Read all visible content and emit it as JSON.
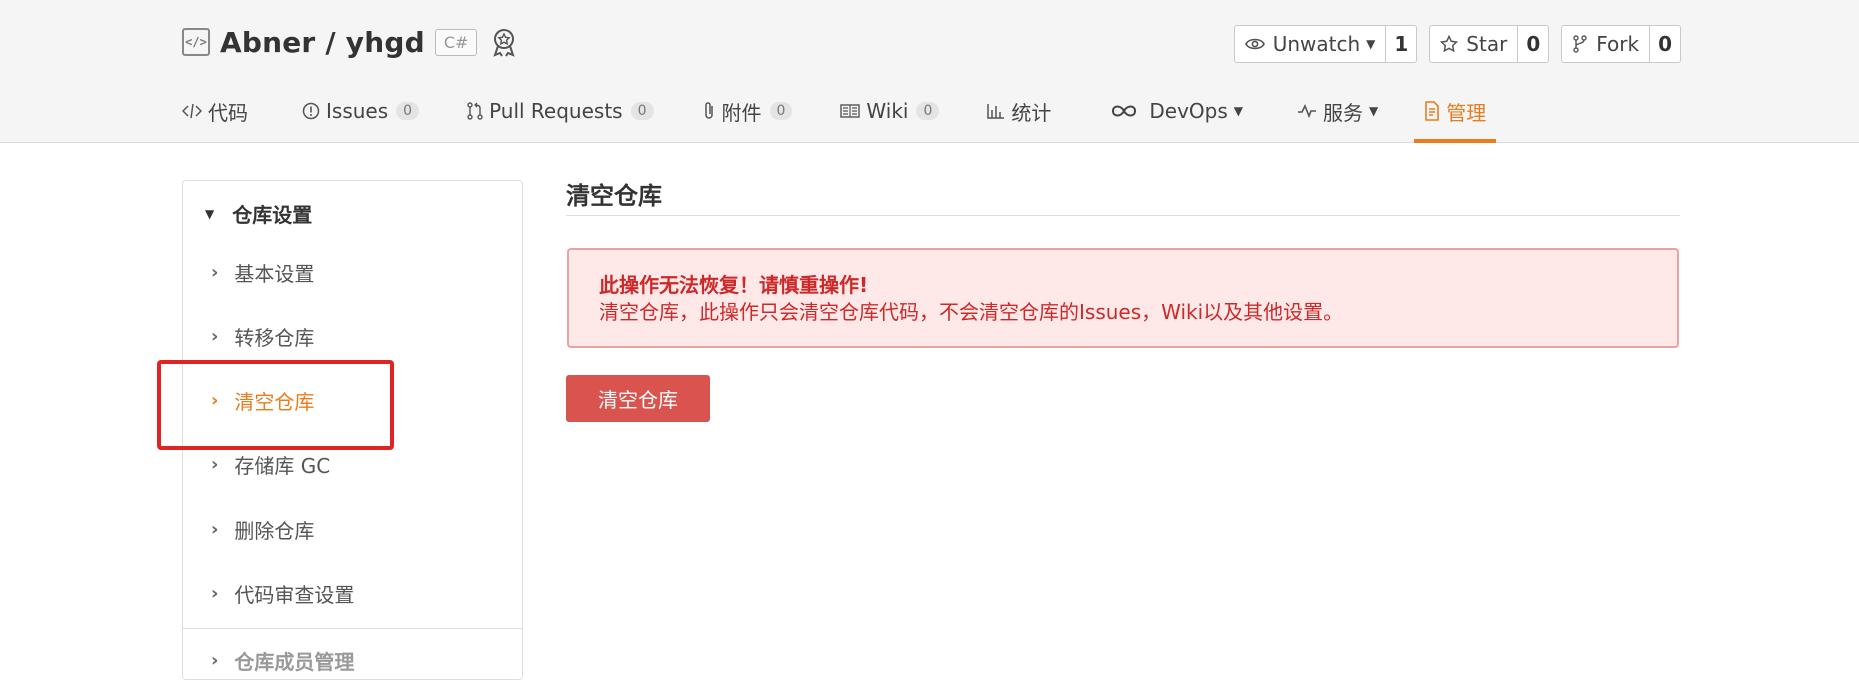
{
  "repo": {
    "owner_repo": "Abner / yhgd",
    "language": "C#"
  },
  "actions": [
    {
      "label": "Unwatch",
      "count": "1",
      "icon": "eye-icon",
      "dropdown": true
    },
    {
      "label": "Star",
      "count": "0",
      "icon": "star-icon",
      "dropdown": false
    },
    {
      "label": "Fork",
      "count": "0",
      "icon": "fork-icon",
      "dropdown": false
    }
  ],
  "nav": [
    {
      "label": "代码",
      "icon": "code-icon"
    },
    {
      "label": "Issues",
      "count": "0",
      "icon": "issue-icon"
    },
    {
      "label": "Pull Requests",
      "count": "0",
      "icon": "pull-request-icon"
    },
    {
      "label": "附件",
      "count": "0",
      "icon": "paperclip-icon"
    },
    {
      "label": "Wiki",
      "count": "0",
      "icon": "book-icon"
    },
    {
      "label": "统计",
      "icon": "bar-chart-icon"
    },
    {
      "label": "DevOps",
      "icon": "infinity-icon"
    },
    {
      "label": "服务",
      "icon": "pulse-icon"
    },
    {
      "label": "管理",
      "icon": "settings-doc-icon",
      "active": true
    }
  ],
  "sidebar": {
    "section_title": "仓库设置",
    "items": [
      {
        "label": "基本设置"
      },
      {
        "label": "转移仓库"
      },
      {
        "label": "清空仓库",
        "active": true
      },
      {
        "label": "存储库 GC"
      },
      {
        "label": "删除仓库"
      },
      {
        "label": "代码审查设置"
      }
    ],
    "next_section": "仓库成员管理"
  },
  "main": {
    "title": "清空仓库",
    "alert_title": "此操作无法恢复！请慎重操作!",
    "alert_message": "清空仓库，此操作只会清空仓库代码，不会清空仓库的Issues，Wiki以及其他设置。",
    "button_label": "清空仓库"
  },
  "colors": {
    "accent": "#e97c1d",
    "danger": "#d9534f",
    "alert_bg": "#ffe8e8",
    "alert_text": "#cc2a2a",
    "highlight": "#e02424"
  }
}
